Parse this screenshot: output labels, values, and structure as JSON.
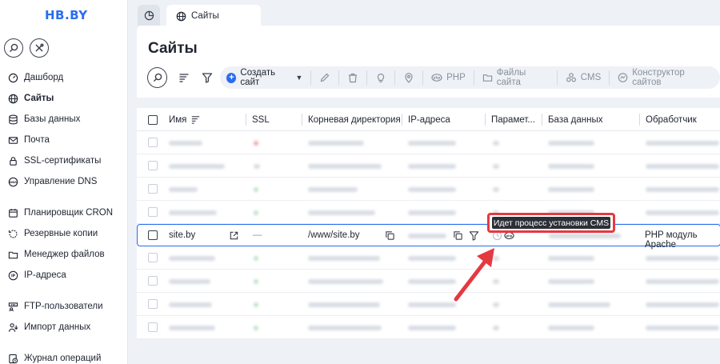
{
  "app": {
    "logo": "HB.BY"
  },
  "sidebar": {
    "items": [
      {
        "label": "Дашборд",
        "icon": "speedometer-icon",
        "active": false
      },
      {
        "label": "Сайты",
        "icon": "globe-icon",
        "active": true
      },
      {
        "label": "Базы данных",
        "icon": "database-icon",
        "active": false
      },
      {
        "label": "Почта",
        "icon": "mail-icon",
        "active": false
      },
      {
        "label": "SSL-сертификаты",
        "icon": "ssl-lock-icon",
        "active": false
      },
      {
        "label": "Управление DNS",
        "icon": "dns-icon",
        "active": false
      },
      {
        "label": "Планировщик CRON",
        "icon": "calendar-icon",
        "active": false
      },
      {
        "label": "Резервные копии",
        "icon": "backup-icon",
        "active": false
      },
      {
        "label": "Менеджер файлов",
        "icon": "folder-icon",
        "active": false
      },
      {
        "label": "IP-адреса",
        "icon": "ip-icon",
        "active": false
      },
      {
        "label": "FTP-пользователи",
        "icon": "ftp-icon",
        "active": false
      },
      {
        "label": "Импорт данных",
        "icon": "import-icon",
        "active": false
      },
      {
        "label": "Журнал операций",
        "icon": "history-icon",
        "active": false
      }
    ]
  },
  "tabs": {
    "sites": "Сайты"
  },
  "page": {
    "title": "Сайты"
  },
  "toolbar": {
    "create": "Создать сайт",
    "php": "PHP",
    "files": "Файлы сайта",
    "cms": "CMS",
    "builder": "Конструктор сайтов"
  },
  "table": {
    "columns": [
      "Имя",
      "SSL",
      "Корневая директория",
      "IP-адреса",
      "Парамет...",
      "База данных",
      "Обработчик"
    ],
    "selected_row": {
      "name": "site.by",
      "ssl": "—",
      "root": "/www/site.by",
      "handler": "PHP модуль Apache"
    }
  },
  "tooltip": {
    "text": "Идет процесс установки CMS"
  },
  "colors": {
    "accent": "#2a6cf0",
    "highlight": "#e53941",
    "tooltip_bg": "#2b2f36"
  }
}
